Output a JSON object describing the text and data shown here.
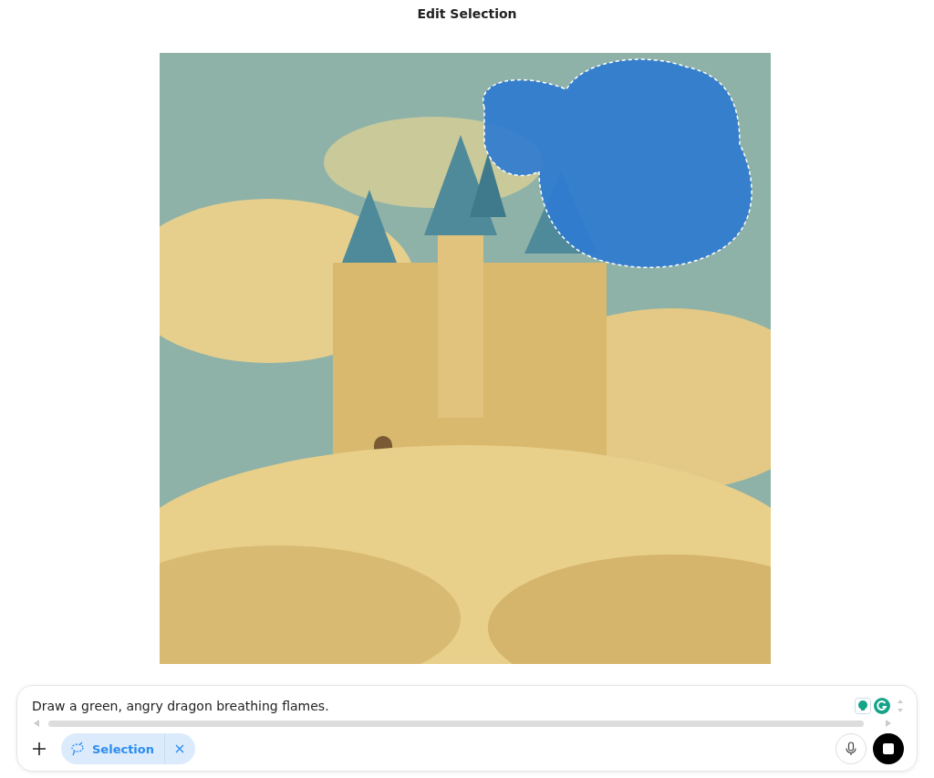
{
  "title": "Edit Selection",
  "composer": {
    "value": "Draw a green, angry dragon breathing flames.",
    "chip": {
      "label": "Selection"
    }
  }
}
